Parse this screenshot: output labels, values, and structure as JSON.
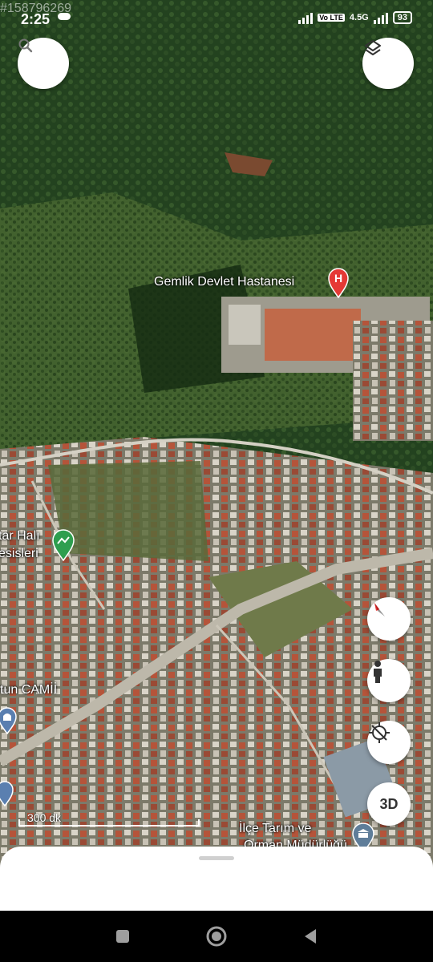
{
  "status_bar": {
    "watermark": "#158796269",
    "time": "2:25",
    "network_tag": "Vo LTE",
    "network_type": "4.5G",
    "battery": "93"
  },
  "map": {
    "labels": {
      "hospital": "Gemlik Devlet Hastanesi",
      "carpet_left": "tar Halı",
      "carpet_left_2": "esisleri",
      "mosque": "tun CAMİİ",
      "directorate_1": "İlçe Tarım ve",
      "directorate_2": "Orman Müdürlüğü"
    },
    "scale_label": "300 dk"
  },
  "controls": {
    "three_d_label": "3D"
  },
  "colors": {
    "hospital_pin": "#e53935",
    "park_pin": "#2e9e4f",
    "compass_red": "#e53935"
  }
}
